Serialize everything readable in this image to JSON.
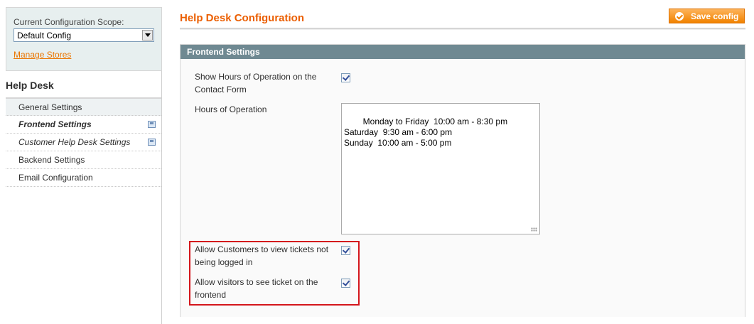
{
  "sidebar": {
    "scope_label": "Current Configuration Scope:",
    "scope_value": "Default Config",
    "manage_stores": "Manage Stores",
    "section_title": "Help Desk",
    "items": [
      {
        "label": "General Settings"
      },
      {
        "label": "Frontend Settings"
      },
      {
        "label": "Customer Help Desk Settings"
      },
      {
        "label": "Backend Settings"
      },
      {
        "label": "Email Configuration"
      }
    ]
  },
  "header": {
    "title": "Help Desk Configuration",
    "save_label": "Save config"
  },
  "fieldset": {
    "title": "Frontend Settings",
    "show_hours_label": "Show Hours of Operation on the Contact Form",
    "show_hours_checked": true,
    "hours_label": "Hours of Operation",
    "hours_value": "Monday to Friday  10:00 am - 8:30 pm\nSaturday  9:30 am - 6:00 pm\nSunday  10:00 am - 5:00 pm",
    "allow_view_label": "Allow Customers to view tickets not being logged in",
    "allow_view_checked": true,
    "allow_visitors_label": "Allow visitors to see ticket on the frontend",
    "allow_visitors_checked": true
  },
  "colors": {
    "title_orange": "#eb5e00",
    "link_orange": "#ea7601",
    "fieldset_header": "#6f8992",
    "highlight_red": "#d4161c"
  }
}
